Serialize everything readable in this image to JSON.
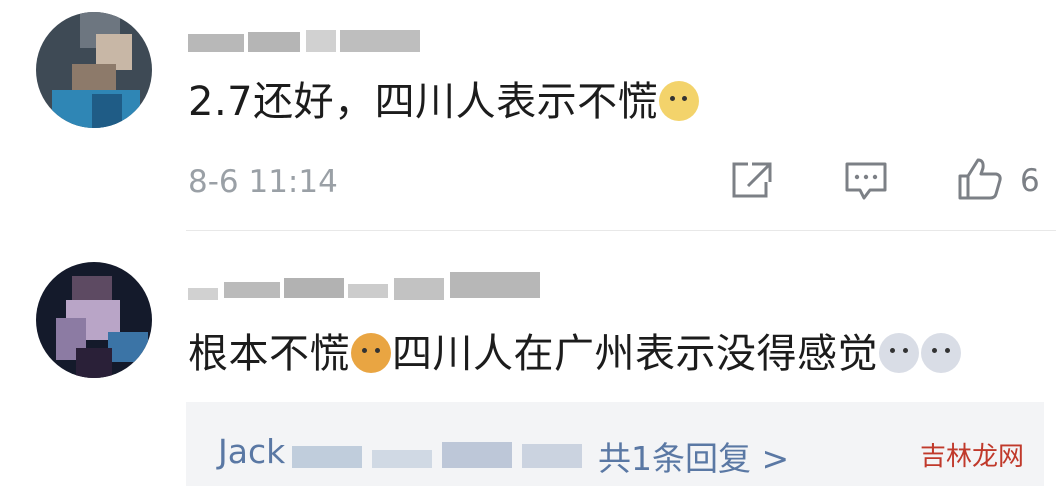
{
  "comments": [
    {
      "username": "五星级小嘿嘿",
      "text": "2.7还好，四川人表示不慌",
      "time": "8-6 11:14",
      "likes": "6"
    },
    {
      "username": "",
      "text_before": "根本不慌",
      "text_after": "四川人在广州表示没得感觉",
      "reply_preview_user": "Jack",
      "reply_count_label": "共1条回复 >"
    }
  ],
  "icons": {
    "share": "share-icon",
    "comment": "comment-icon",
    "like": "thumbs-up-icon",
    "emoji1": "doge-emoji-icon",
    "emoji2": "cat-emoji-icon",
    "emoji3": "husky-emoji-icon"
  },
  "watermark": "吉林龙网",
  "colors": {
    "link": "#5a78a4",
    "meta": "#9aa0a6",
    "reply_bg": "#f3f4f6",
    "watermark": "#c0392b"
  }
}
